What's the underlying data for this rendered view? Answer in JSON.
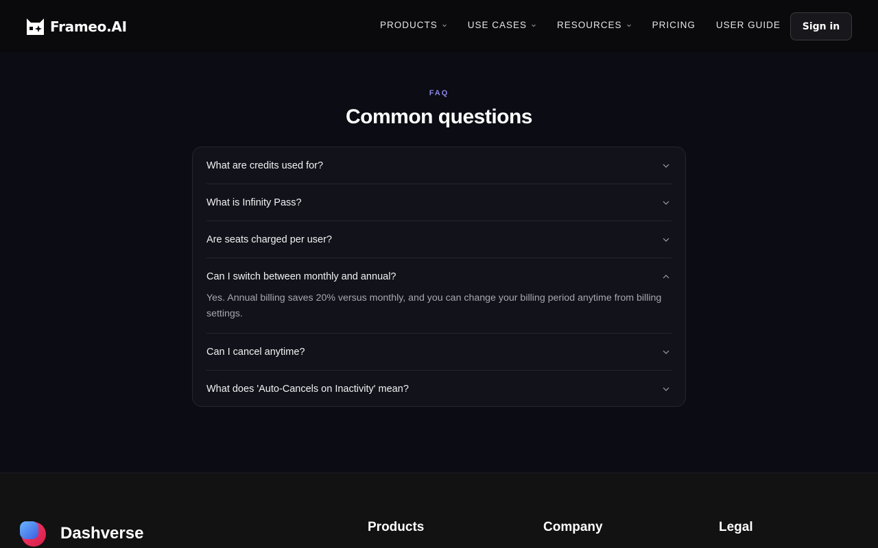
{
  "header": {
    "brand": "Frameo.AI",
    "nav": [
      {
        "label": "PRODUCTS",
        "has_menu": true
      },
      {
        "label": "USE CASES",
        "has_menu": true
      },
      {
        "label": "RESOURCES",
        "has_menu": true
      },
      {
        "label": "PRICING",
        "has_menu": false
      },
      {
        "label": "USER GUIDE",
        "has_menu": false
      }
    ],
    "sign_in": "Sign in"
  },
  "faq": {
    "eyebrow": "FAQ",
    "title": "Common questions",
    "items": [
      {
        "question": "What are credits used for?",
        "expanded": false
      },
      {
        "question": "What is Infinity Pass?",
        "expanded": false
      },
      {
        "question": "Are seats charged per user?",
        "expanded": false
      },
      {
        "question": "Can I switch between monthly and annual?",
        "expanded": true,
        "answer": "Yes. Annual billing saves 20% versus monthly, and you can change your billing period anytime from billing settings."
      },
      {
        "question": "Can I cancel anytime?",
        "expanded": false
      },
      {
        "question": "What does 'Auto-Cancels on Inactivity' mean?",
        "expanded": false
      }
    ]
  },
  "footer": {
    "brand": "Dashverse",
    "columns": [
      "Products",
      "Company",
      "Legal"
    ]
  },
  "colors": {
    "background": "#0b0c14",
    "accent": "#8b86e6",
    "card": "#12121a"
  }
}
